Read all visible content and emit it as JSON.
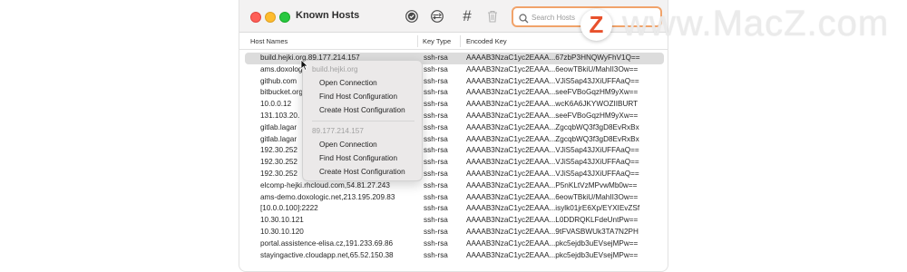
{
  "window": {
    "title": "Known Hosts"
  },
  "toolbar": {
    "icons": [
      "check-circle-icon",
      "network-icon",
      "hashtag-icon",
      "trash-icon"
    ],
    "hashtag_glyph": "#"
  },
  "search": {
    "placeholder": "Search Hosts",
    "value": ""
  },
  "table": {
    "columns": [
      "Host Names",
      "Key Type",
      "Encoded Key"
    ],
    "rows": [
      {
        "host": "build.hejki.org,89.177.214.157",
        "type": "ssh-rsa",
        "key": "AAAAB3NzaC1yc2EAAA...67zbP3HNQWyFhV1Q=="
      },
      {
        "host": "ams.doxologic.net,213.195.209.83",
        "type": "ssh-rsa",
        "key": "AAAAB3NzaC1yc2EAAA...6eowTBkiU/MahII3Ow=="
      },
      {
        "host": "github.com",
        "type": "ssh-rsa",
        "key": "AAAAB3NzaC1yc2EAAA...VJiS5ap43JXiUFFAaQ=="
      },
      {
        "host": "bitbucket.org",
        "type": "ssh-rsa",
        "key": "AAAAB3NzaC1yc2EAAA...seeFVBoGqzHM9yXw=="
      },
      {
        "host": "10.0.0.12",
        "type": "ssh-rsa",
        "key": "AAAAB3NzaC1yc2EAAA...wcK6A6JKYWOZIIBURT"
      },
      {
        "host": "131.103.20.",
        "type": "ssh-rsa",
        "key": "AAAAB3NzaC1yc2EAAA...seeFVBoGqzHM9yXw=="
      },
      {
        "host": "gitlab.lagar",
        "type": "ssh-rsa",
        "key": "AAAAB3NzaC1yc2EAAA...ZgcqbWQ3f3gD8EvRxBx"
      },
      {
        "host": "gitlab.lagar",
        "type": "ssh-rsa",
        "key": "AAAAB3NzaC1yc2EAAA...ZgcqbWQ3f3gD8EvRxBx"
      },
      {
        "host": "192.30.252",
        "type": "ssh-rsa",
        "key": "AAAAB3NzaC1yc2EAAA...VJiS5ap43JXiUFFAaQ=="
      },
      {
        "host": "192.30.252",
        "type": "ssh-rsa",
        "key": "AAAAB3NzaC1yc2EAAA...VJiS5ap43JXiUFFAaQ=="
      },
      {
        "host": "192.30.252",
        "type": "ssh-rsa",
        "key": "AAAAB3NzaC1yc2EAAA...VJiS5ap43JXiUFFAaQ=="
      },
      {
        "host": "elcomp-hejki.rhcloud.com,54.81.27.243",
        "type": "ssh-rsa",
        "key": "AAAAB3NzaC1yc2EAAA...P5nKLtVzMPvwMb0w=="
      },
      {
        "host": "ams-demo.doxologic.net,213.195.209.83",
        "type": "ssh-rsa",
        "key": "AAAAB3NzaC1yc2EAAA...6eowTBkiU/MahII3Ow=="
      },
      {
        "host": "[10.0.0.100]:2222",
        "type": "ssh-rsa",
        "key": "AAAAB3NzaC1yc2EAAA...isylk01jrE6Xp/EYXIEvZSf"
      },
      {
        "host": "10.30.10.121",
        "type": "ssh-rsa",
        "key": "AAAAB3NzaC1yc2EAAA...L0DDRQKLFdeUntPw=="
      },
      {
        "host": "10.30.10.120",
        "type": "ssh-rsa",
        "key": "AAAAB3NzaC1yc2EAAA...9tFVASBWUk3TA7N2PH"
      },
      {
        "host": "portal.assistence-elisa.cz,191.233.69.86",
        "type": "ssh-rsa",
        "key": "AAAAB3NzaC1yc2EAAA...pkc5ejdb3uEVsejMPw=="
      },
      {
        "host": "stayingactive.cloudapp.net,65.52.150.38",
        "type": "ssh-rsa",
        "key": "AAAAB3NzaC1yc2EAAA...pkc5ejdb3uEVsejMPw=="
      }
    ]
  },
  "context_menu": {
    "sections": [
      {
        "header": "build.hejki.org",
        "items": [
          "Open Connection",
          "Find Host Configuration",
          "Create Host Configuration"
        ]
      },
      {
        "header": "89.177.214.157",
        "items": [
          "Open Connection",
          "Find Host Configuration",
          "Create Host Configuration"
        ]
      }
    ]
  },
  "watermark": {
    "badge_letter": "Z",
    "text": "www.MacZ.com"
  },
  "colors": {
    "search_focus": "#f1a36a",
    "selection": "#dcdcdc",
    "watermark_accent": "#e8512c"
  }
}
